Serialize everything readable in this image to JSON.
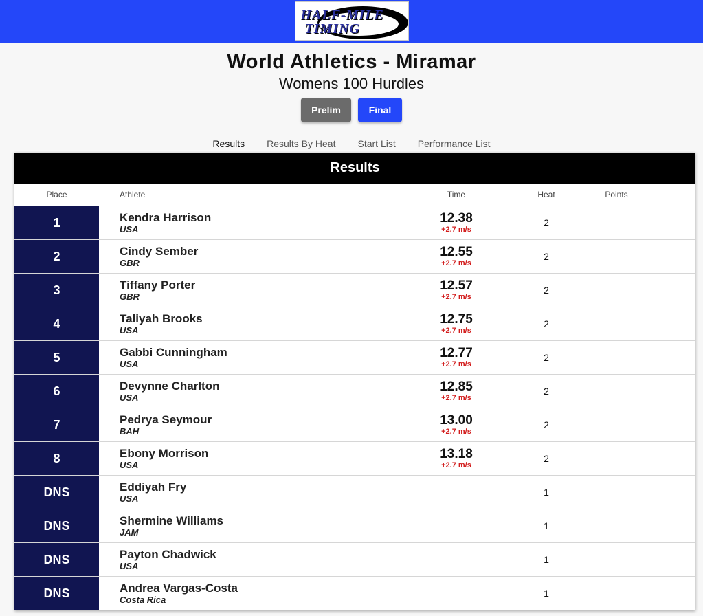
{
  "logo": {
    "line1": "HALF-MILE",
    "line2": "TIMING"
  },
  "meet": {
    "title": "World Athletics - Miramar",
    "event": "Womens 100 Hurdles"
  },
  "rounds": {
    "prelim": "Prelim",
    "final": "Final",
    "active": "final"
  },
  "tabs": [
    "Results",
    "Results By Heat",
    "Start List",
    "Performance List"
  ],
  "panel": {
    "title": "Results"
  },
  "columns": {
    "place": "Place",
    "athlete": "Athlete",
    "time": "Time",
    "heat": "Heat",
    "points": "Points"
  },
  "colors": {
    "brand": "#2447f9",
    "place_bg": "#111551",
    "wind": "#d21b1b"
  },
  "results": [
    {
      "place": "1",
      "name": "Kendra Harrison",
      "team": "USA",
      "time": "12.38",
      "wind": "+2.7 m/s",
      "heat": "2",
      "points": ""
    },
    {
      "place": "2",
      "name": "Cindy Sember",
      "team": "GBR",
      "time": "12.55",
      "wind": "+2.7 m/s",
      "heat": "2",
      "points": ""
    },
    {
      "place": "3",
      "name": "Tiffany Porter",
      "team": "GBR",
      "time": "12.57",
      "wind": "+2.7 m/s",
      "heat": "2",
      "points": ""
    },
    {
      "place": "4",
      "name": "Taliyah Brooks",
      "team": "USA",
      "time": "12.75",
      "wind": "+2.7 m/s",
      "heat": "2",
      "points": ""
    },
    {
      "place": "5",
      "name": "Gabbi Cunningham",
      "team": "USA",
      "time": "12.77",
      "wind": "+2.7 m/s",
      "heat": "2",
      "points": ""
    },
    {
      "place": "6",
      "name": "Devynne Charlton",
      "team": "USA",
      "time": "12.85",
      "wind": "+2.7 m/s",
      "heat": "2",
      "points": ""
    },
    {
      "place": "7",
      "name": "Pedrya Seymour",
      "team": "BAH",
      "time": "13.00",
      "wind": "+2.7 m/s",
      "heat": "2",
      "points": ""
    },
    {
      "place": "8",
      "name": "Ebony Morrison",
      "team": "USA",
      "time": "13.18",
      "wind": "+2.7 m/s",
      "heat": "2",
      "points": ""
    },
    {
      "place": "DNS",
      "name": "Eddiyah Fry",
      "team": "USA",
      "time": "",
      "wind": "",
      "heat": "1",
      "points": ""
    },
    {
      "place": "DNS",
      "name": "Shermine Williams",
      "team": "JAM",
      "time": "",
      "wind": "",
      "heat": "1",
      "points": ""
    },
    {
      "place": "DNS",
      "name": "Payton Chadwick",
      "team": "USA",
      "time": "",
      "wind": "",
      "heat": "1",
      "points": ""
    },
    {
      "place": "DNS",
      "name": "Andrea Vargas-Costa",
      "team": "Costa Rica",
      "time": "",
      "wind": "",
      "heat": "1",
      "points": ""
    }
  ]
}
